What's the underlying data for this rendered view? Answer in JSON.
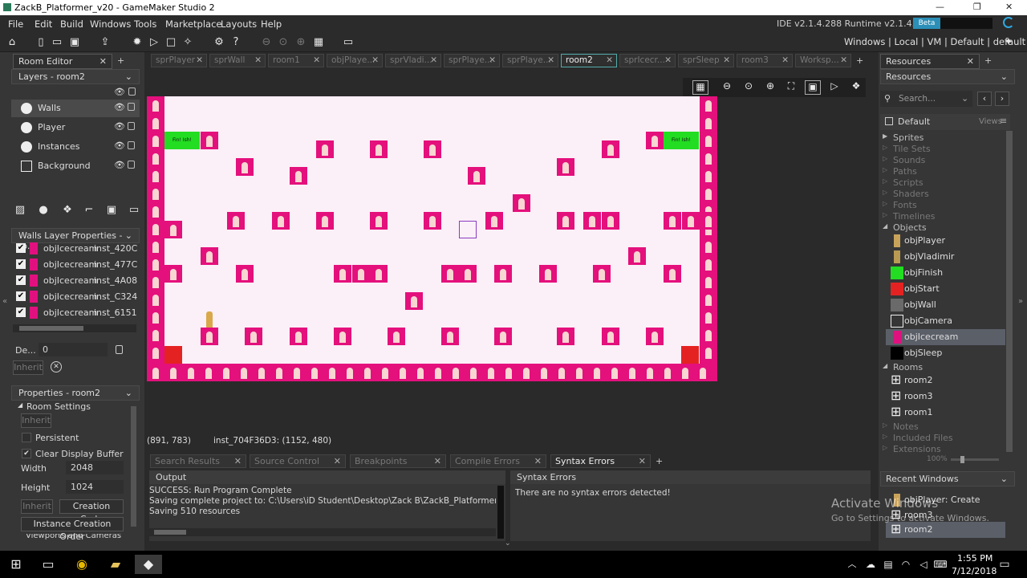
{
  "window": {
    "title": "ZackB_Platformer_v20 - GameMaker Studio 2",
    "min": "—",
    "max": "❐",
    "close": "✕"
  },
  "menu": [
    "File",
    "Edit",
    "Build",
    "Windows",
    "Tools",
    "Marketplace",
    "Layouts",
    "Help"
  ],
  "ide": {
    "version": "IDE v2.1.4.288 Runtime v2.1.4.212",
    "badge": "Beta",
    "target": "Windows | Local | VM | Default | default"
  },
  "room_editor": {
    "tab": "Room Editor",
    "layers_title": "Layers - room2",
    "layers": [
      "Walls",
      "Player",
      "Instances",
      "Background"
    ],
    "walls_props_title": "Walls Layer Properties - ro...",
    "instances": [
      {
        "name": "objIcecream",
        "id": "inst_420C"
      },
      {
        "name": "objIcecream",
        "id": "inst_477C"
      },
      {
        "name": "objIcecream",
        "id": "inst_4A08"
      },
      {
        "name": "objIcecream",
        "id": "inst_C324"
      },
      {
        "name": "objIcecream",
        "id": "inst_6151"
      }
    ],
    "depth_label": "De...",
    "depth_value": "0",
    "inherit": "Inherit",
    "props_title": "Properties - room2",
    "room_settings": "Room Settings",
    "persistent": "Persistent",
    "clear_display": "Clear Display Buffer",
    "width_label": "Width",
    "width": "2048",
    "height_label": "Height",
    "height": "1024",
    "creation_code": "Creation Code",
    "instance_order": "Instance Creation Order",
    "viewports": "Viewports and Cameras"
  },
  "tabs": [
    "sprPlayer",
    "sprWall",
    "room1",
    "objPlaye...",
    "sprVladi...",
    "sprPlaye...",
    "sprPlaye...",
    "room2",
    "sprIcecr...",
    "sprSleep",
    "room3",
    "Worksp..."
  ],
  "status": {
    "coords": "(891, 783)",
    "instance": "inst_704F36D3: (1152, 480)"
  },
  "finish_label": "Fin! Ish!",
  "bottom_tabs": [
    "Search Results",
    "Source Control",
    "Breakpoints",
    "Compile Errors",
    "Syntax Errors"
  ],
  "output": {
    "title": "Output",
    "lines": [
      "SUCCESS: Run Program Complete",
      "Saving complete project to: C:\\Users\\iD Student\\Desktop\\Zack B\\ZackB_Platformer_v20\\ZackB",
      "Saving 510 resources"
    ]
  },
  "syntax": {
    "title": "Syntax Errors",
    "message": "There are no syntax errors detected!"
  },
  "resources": {
    "tab": "Resources",
    "dropdown": "Resources",
    "search_placeholder": "Search...",
    "default": "Default",
    "views": "Views",
    "categories_top": [
      "Sprites",
      "Tile Sets",
      "Sounds",
      "Paths",
      "Scripts",
      "Shaders",
      "Fonts",
      "Timelines"
    ],
    "objects_label": "Objects",
    "objects": [
      "objPlayer",
      "objVladimir",
      "objFinish",
      "objStart",
      "objWall",
      "objCamera",
      "objIcecream",
      "objSleep"
    ],
    "rooms_label": "Rooms",
    "rooms": [
      "room2",
      "room3",
      "room1"
    ],
    "categories_bottom": [
      "Notes",
      "Included Files",
      "Extensions"
    ],
    "zoom": "100%"
  },
  "recent": {
    "title": "Recent Windows",
    "items": [
      "objPlayer: Create",
      "room3",
      "room2"
    ]
  },
  "watermark": {
    "line1": "Activate Windows",
    "line2": "Go to Settings to activate Windows."
  },
  "taskbar": {
    "time": "1:55 PM",
    "date": "7/12/2018"
  }
}
